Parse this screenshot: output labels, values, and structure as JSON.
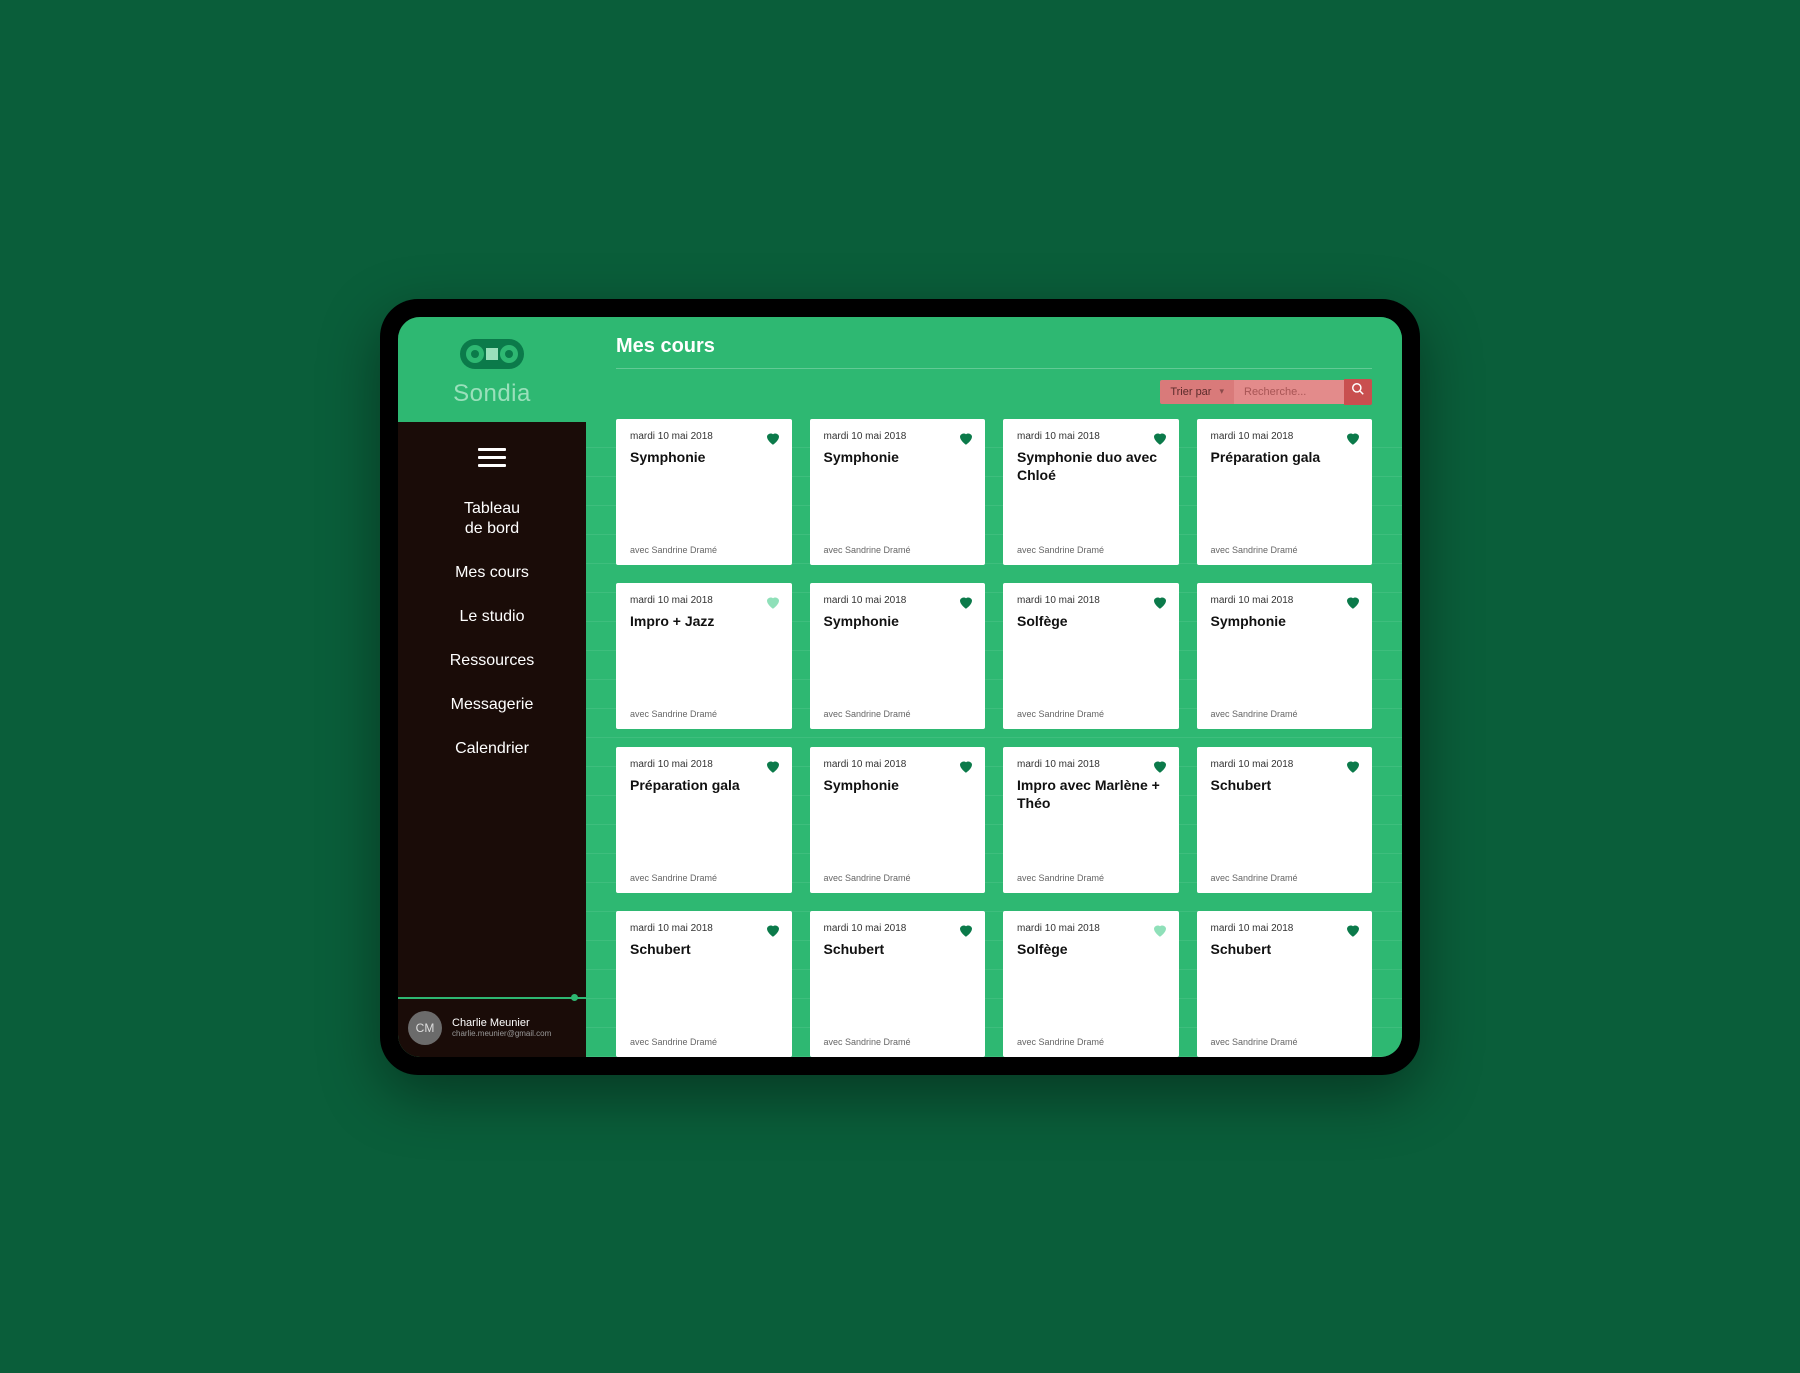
{
  "brand": {
    "name": "Sondia"
  },
  "nav": {
    "items": [
      {
        "label": "Tableau\nde bord"
      },
      {
        "label": "Mes cours"
      },
      {
        "label": "Le studio"
      },
      {
        "label": "Ressources"
      },
      {
        "label": "Messagerie"
      },
      {
        "label": "Calendrier"
      }
    ]
  },
  "user": {
    "initials": "CM",
    "name": "Charlie Meunier",
    "email": "charlie.meunier@gmail.com"
  },
  "page": {
    "title": "Mes cours"
  },
  "toolbar": {
    "sort_label": "Trier par",
    "search_placeholder": "Recherche..."
  },
  "courses": [
    {
      "date": "mardi 10 mai 2018",
      "title": "Symphonie",
      "with": "avec Sandrine Dramé",
      "favorite": true
    },
    {
      "date": "mardi 10 mai 2018",
      "title": "Symphonie",
      "with": "avec Sandrine Dramé",
      "favorite": true
    },
    {
      "date": "mardi 10 mai 2018",
      "title": "Symphonie duo avec Chloé",
      "with": "avec Sandrine Dramé",
      "favorite": true
    },
    {
      "date": "mardi 10 mai 2018",
      "title": "Préparation gala",
      "with": "avec Sandrine Dramé",
      "favorite": true
    },
    {
      "date": "mardi 10 mai 2018",
      "title": "Impro + Jazz",
      "with": "avec Sandrine Dramé",
      "favorite": false
    },
    {
      "date": "mardi 10 mai 2018",
      "title": "Symphonie",
      "with": "avec Sandrine Dramé",
      "favorite": true
    },
    {
      "date": "mardi 10 mai 2018",
      "title": "Solfège",
      "with": "avec Sandrine Dramé",
      "favorite": true
    },
    {
      "date": "mardi 10 mai 2018",
      "title": "Symphonie",
      "with": "avec Sandrine Dramé",
      "favorite": true
    },
    {
      "date": "mardi 10 mai 2018",
      "title": "Préparation gala",
      "with": "avec Sandrine Dramé",
      "favorite": true
    },
    {
      "date": "mardi 10 mai 2018",
      "title": "Symphonie",
      "with": "avec Sandrine Dramé",
      "favorite": true
    },
    {
      "date": "mardi 10 mai 2018",
      "title": "Impro avec Marlène + Théo",
      "with": "avec Sandrine Dramé",
      "favorite": true
    },
    {
      "date": "mardi 10 mai 2018",
      "title": "Schubert",
      "with": "avec Sandrine Dramé",
      "favorite": true
    },
    {
      "date": "mardi 10 mai 2018",
      "title": "Schubert",
      "with": "avec Sandrine Dramé",
      "favorite": true
    },
    {
      "date": "mardi 10 mai 2018",
      "title": "Schubert",
      "with": "avec Sandrine Dramé",
      "favorite": true
    },
    {
      "date": "mardi 10 mai 2018",
      "title": "Solfège",
      "with": "avec Sandrine Dramé",
      "favorite": false
    },
    {
      "date": "mardi 10 mai 2018",
      "title": "Schubert",
      "with": "avec Sandrine Dramé",
      "favorite": true
    }
  ]
}
